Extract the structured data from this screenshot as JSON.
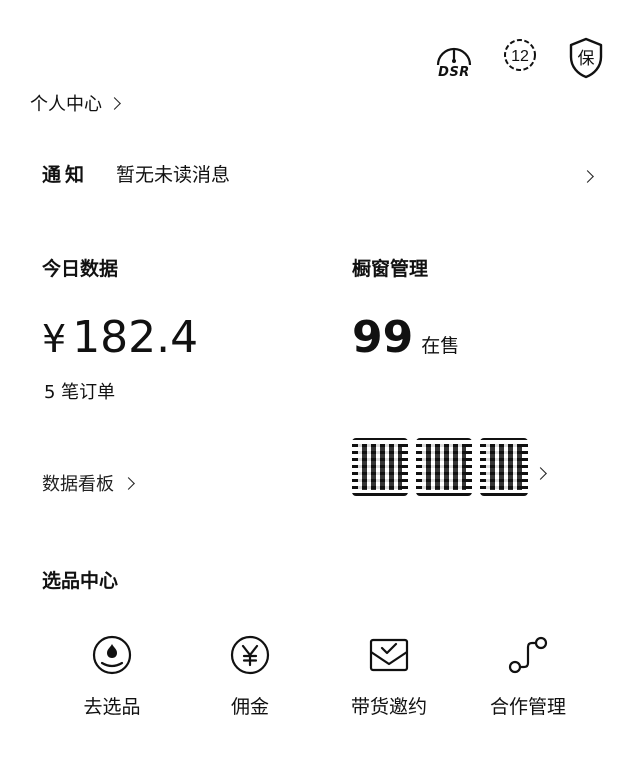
{
  "header": {
    "dsr_label": "DSR",
    "badge_number": "12",
    "shield_text": "保",
    "personal_center": "个人中心"
  },
  "notice": {
    "label": "通知",
    "text": "暂无未读消息"
  },
  "today": {
    "title": "今日数据",
    "currency": "¥",
    "amount": "182.4",
    "orders": "5 笔订单",
    "dashboard_link": "数据看板"
  },
  "window": {
    "title": "橱窗管理",
    "count": "99",
    "unit": "在售"
  },
  "selection": {
    "title": "选品中心",
    "tools": [
      {
        "label": "去选品",
        "icon": "select-product-icon"
      },
      {
        "label": "佣金",
        "icon": "yuan-coin-icon"
      },
      {
        "label": "带货邀约",
        "icon": "invite-envelope-icon"
      },
      {
        "label": "合作管理",
        "icon": "cooperation-flow-icon"
      }
    ]
  }
}
